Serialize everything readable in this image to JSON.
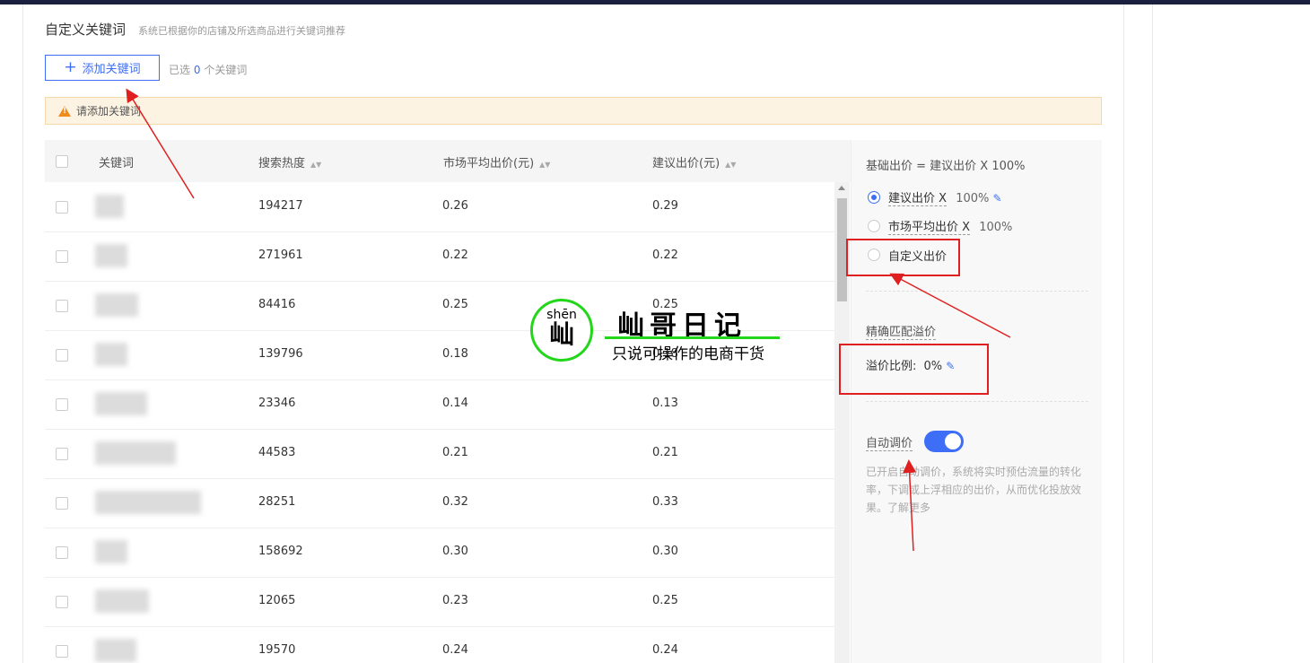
{
  "header": {
    "title": "自定义关键词",
    "subtitle": "系统已根据你的店铺及所选商品进行关键词推荐",
    "add_button": "添加关键词",
    "selected_prefix": "已选",
    "selected_count": "0",
    "selected_suffix": "个关键词"
  },
  "warning": {
    "text": "请添加关键词"
  },
  "table": {
    "columns": [
      "关键词",
      "搜索热度",
      "市场平均出价(元)",
      "建议出价(元)"
    ],
    "rows": [
      {
        "heat": "194217",
        "avg": "0.26",
        "suggest": "0.29"
      },
      {
        "heat": "271961",
        "avg": "0.22",
        "suggest": "0.22"
      },
      {
        "heat": "84416",
        "avg": "0.25",
        "suggest": "0.25"
      },
      {
        "heat": "139796",
        "avg": "0.18",
        "suggest": "0.18"
      },
      {
        "heat": "23346",
        "avg": "0.14",
        "suggest": "0.13"
      },
      {
        "heat": "44583",
        "avg": "0.21",
        "suggest": "0.21"
      },
      {
        "heat": "28251",
        "avg": "0.32",
        "suggest": "0.33"
      },
      {
        "heat": "158692",
        "avg": "0.30",
        "suggest": "0.30"
      },
      {
        "heat": "12065",
        "avg": "0.23",
        "suggest": "0.25"
      },
      {
        "heat": "19570",
        "avg": "0.24",
        "suggest": "0.24"
      }
    ]
  },
  "panel": {
    "base_formula": "基础出价 = 建议出价 X 100%",
    "options": [
      {
        "label": "建议出价 X",
        "value": "100%",
        "selected": true
      },
      {
        "label": "市场平均出价 X",
        "value": "100%",
        "selected": false
      },
      {
        "label": "自定义出价",
        "value": "",
        "selected": false
      }
    ],
    "precise_title": "精确匹配溢价",
    "premium_label": "溢价比例:",
    "premium_value": "0%",
    "auto_label": "自动调价",
    "auto_enabled": true,
    "auto_desc": "已开启自动调价，系统将实时预估流量的转化率，下调或上浮相应的出价，从而优化投放效果。了解更多"
  },
  "watermark": {
    "pinyin": "shēn",
    "char": "屾",
    "title": "屾哥日记",
    "subtitle": "只说可操作的电商干货"
  },
  "colors": {
    "accent": "#3d6ef5",
    "annotation": "#e02020",
    "warning_bg": "#fdf3e3"
  }
}
